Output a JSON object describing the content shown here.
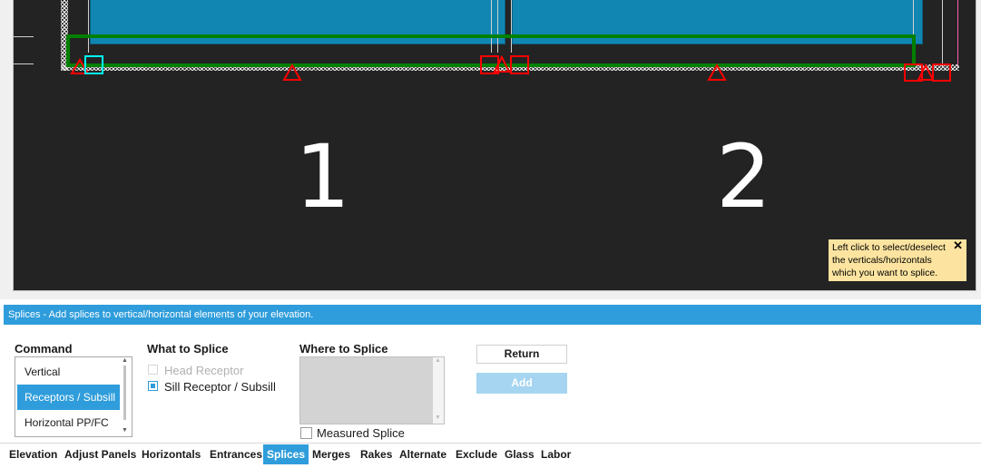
{
  "canvas": {
    "panel_numbers": [
      "1",
      "2"
    ],
    "tooltip": {
      "text": "Left click to select/deselect the verticals/horizontals which you want to splice.",
      "close": "✕"
    }
  },
  "status_bar": {
    "text": "Splices - Add splices to vertical/horizontal elements of your elevation."
  },
  "command": {
    "heading": "Command",
    "items": [
      "Vertical",
      "Receptors / Subsill",
      "Horizontal PP/FC"
    ],
    "selected": "Receptors / Subsill"
  },
  "what_to_splice": {
    "heading": "What to Splice",
    "options": [
      {
        "label": "Head Receptor",
        "checked": false,
        "enabled": false
      },
      {
        "label": "Sill Receptor / Subsill",
        "checked": true,
        "enabled": true
      }
    ]
  },
  "where_to_splice": {
    "heading": "Where to Splice",
    "measured_label": "Measured Splice",
    "measured_checked": false
  },
  "buttons": {
    "return": "Return",
    "add": "Add"
  },
  "tabs": [
    "Elevation",
    "Adjust Panels",
    "Horizontals",
    "Entrances",
    "Splices",
    "Merges",
    "Rakes",
    "Alternate",
    "Exclude",
    "Glass",
    "Labor"
  ],
  "active_tab": "Splices",
  "colors": {
    "accent": "#2f9ddb",
    "glass": "#1286b3",
    "selection": "#008000",
    "splice_marker": "#ff0000",
    "selected_marker": "#00ffff",
    "tooltip": "#fce4a0"
  }
}
